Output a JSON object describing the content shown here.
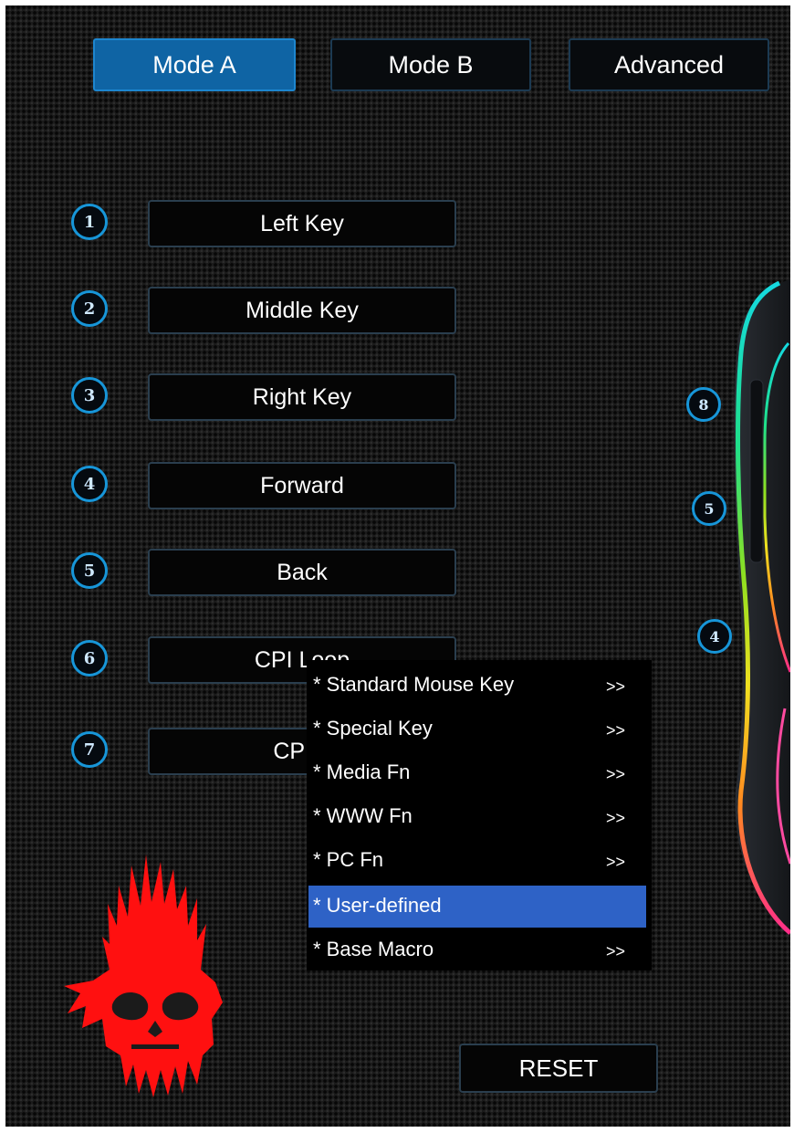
{
  "tabs": [
    {
      "label": "Mode A",
      "active": true
    },
    {
      "label": "Mode B",
      "active": false
    },
    {
      "label": "Advanced",
      "active": false
    }
  ],
  "keys": [
    {
      "num": "1",
      "label": "Left Key"
    },
    {
      "num": "2",
      "label": "Middle Key"
    },
    {
      "num": "3",
      "label": "Right Key"
    },
    {
      "num": "4",
      "label": "Forward"
    },
    {
      "num": "5",
      "label": "Back"
    },
    {
      "num": "6",
      "label": "CPI Loop"
    },
    {
      "num": "7",
      "label": "CPI +"
    }
  ],
  "menu": {
    "items": [
      {
        "label": "* Standard Mouse Key",
        "arrow": ">>"
      },
      {
        "label": "* Special Key",
        "arrow": ">>"
      },
      {
        "label": "* Media Fn",
        "arrow": ">>"
      },
      {
        "label": "* WWW Fn",
        "arrow": ">>"
      },
      {
        "label": "* PC Fn",
        "arrow": ">>"
      },
      {
        "label": "* User-defined",
        "arrow": "",
        "highlighted": true
      },
      {
        "label": "* Base Macro",
        "arrow": ">>"
      }
    ]
  },
  "mouse_badges": [
    "8",
    "5",
    "4"
  ],
  "reset_label": "RESET",
  "colors": {
    "accent": "#1796d9",
    "active_tab": "#0f64a4",
    "menu_highlight": "#2e62c6",
    "skull": "#ff1010"
  }
}
